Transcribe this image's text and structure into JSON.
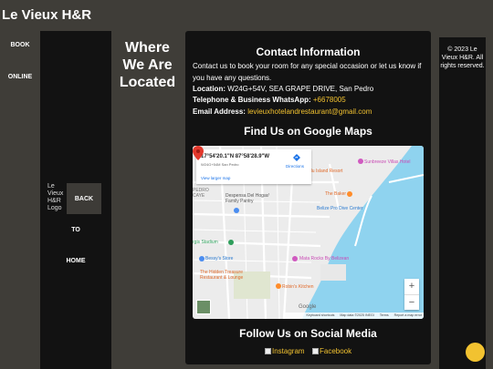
{
  "header": {
    "site_title": "Le Vieux H&R"
  },
  "side_nav": {
    "book_label": "BOOK",
    "online_label": "ONLINE"
  },
  "logo_column": {
    "logo_alt": "Le Vieux H&R Logo",
    "back_label": "BACK",
    "to_label": "TO",
    "home_label": "HOME"
  },
  "where": {
    "title": "Where We Are Located"
  },
  "contact": {
    "title": "Contact Information",
    "intro": "Contact us to book your room for any special occasion or let us know if you have any questions.",
    "location_label": "Location:",
    "location_value": "W24G+54V, SEA GRAPE DRIVE, San Pedro",
    "phone_label": "Telephone & Business WhatsApp:",
    "phone_value": "+6678005",
    "email_label": "Email Address:",
    "email_value": "levieuxhotelandrestaurant@gmail.com"
  },
  "maps": {
    "title": "Find Us on Google Maps",
    "coords": "17°54'20.1\"N 87°58'28.9\"W",
    "plus_code": "W24G+54M San Pedro",
    "directions_label": "Directions",
    "larger_map_label": "View larger map",
    "labels": {
      "island_resort": "du Island Resort",
      "sunbreeze": "Sunbreeze Villas Hotel",
      "the_baker": "The Baker",
      "belize_pro": "Belize Pro Dive Center",
      "despensa": "Despensa Del Hogar/ Family Pantry",
      "pedro_caye": "PEDRO CAYE",
      "stadium": "rgis Stadium",
      "bessy": "Bessy's Store",
      "mata_rocks": "Mata Rocks By Belizean",
      "hidden_treasure": "The Hidden Treasure Restaurant & Lounge",
      "robins": "Robin's Kitchen"
    },
    "zoom_in": "+",
    "zoom_out": "−",
    "google": "Google",
    "footer": {
      "shortcuts": "Keyboard shortcuts",
      "mapdata": "Map data ©2025 INEGI",
      "terms": "Terms",
      "report": "Report a map error"
    }
  },
  "social": {
    "title": "Follow Us on Social Media",
    "instagram": "Instagram",
    "facebook": "Facebook"
  },
  "footer": {
    "copyright": "© 2023 Le Vieux H&R. All rights reserved."
  },
  "colors": {
    "accent": "#f2c230",
    "panel": "#121212",
    "background": "#3f3d38",
    "water": "#8fd3ef"
  }
}
